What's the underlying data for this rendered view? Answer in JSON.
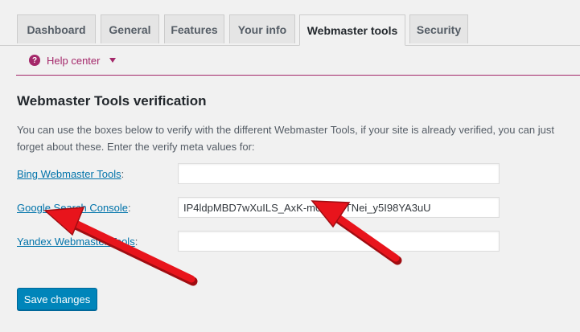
{
  "tabs": [
    {
      "label": "Dashboard"
    },
    {
      "label": "General"
    },
    {
      "label": "Features"
    },
    {
      "label": "Your info"
    },
    {
      "label": "Webmaster tools",
      "active": true
    },
    {
      "label": "Security"
    }
  ],
  "help": {
    "label": "Help center",
    "icon": "question-circle-icon"
  },
  "section": {
    "title": "Webmaster Tools verification",
    "description": "You can use the boxes below to verify with the different Webmaster Tools, if your site is already verified, you can just forget about these. Enter the verify meta values for:"
  },
  "fields": [
    {
      "label": "Bing Webmaster Tools",
      "value": ""
    },
    {
      "label": "Google Search Console",
      "value": "IP4ldpMBD7wXuILS_AxK-m0UrV9TNei_y5I98YA3uU"
    },
    {
      "label": "Yandex Webmaster Tools",
      "value": ""
    }
  ],
  "save_label": "Save changes",
  "colors": {
    "accent": "#a4286a",
    "link": "#0073aa",
    "button": "#0085ba",
    "arrow": "#e8141c"
  }
}
